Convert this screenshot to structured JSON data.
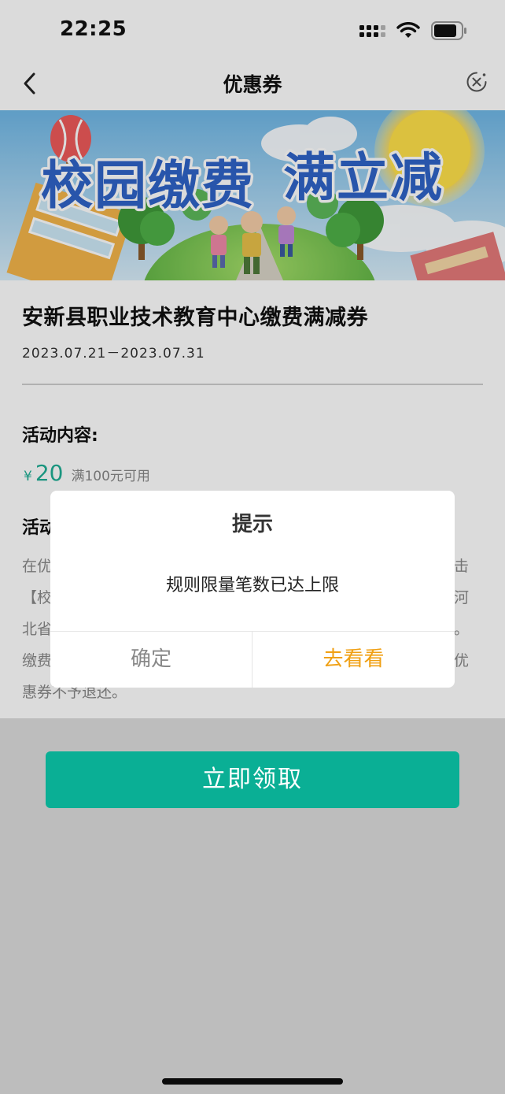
{
  "status": {
    "time": "22:25",
    "icons": [
      "cellular-signal-icon",
      "wifi-icon",
      "battery-icon"
    ]
  },
  "nav": {
    "title": "优惠券",
    "back_icon": "chevron-left-icon",
    "close_icon": "close-circle-icon"
  },
  "banner": {
    "text_line1": "校园缴费",
    "text_line2": "满立减"
  },
  "coupon": {
    "name": "安新县职业技术教育中心缴费满减券",
    "dates": "2023.07.21－2023.07.31"
  },
  "activity": {
    "content_heading": "活动内容:",
    "currency_symbol": "¥",
    "amount": "20",
    "condition": "满100元可用",
    "rules_heading": "活动",
    "rules_lines": [
      "在优",
      "【校",
      "北省",
      "缴费",
      "惠券不予退还。"
    ],
    "rules_line_ends": [
      "击",
      "河",
      "。",
      "优"
    ]
  },
  "actions": {
    "claim_label": "立即领取"
  },
  "dialog": {
    "title": "提示",
    "message": "规则限量笔数已达上限",
    "confirm_label": "确定",
    "goto_label": "去看看"
  },
  "colors": {
    "accent_green": "#0aaf95",
    "amount_green": "#1fae94",
    "dialog_go_orange": "#f0a014",
    "page_bg": "#dcdcdc"
  }
}
